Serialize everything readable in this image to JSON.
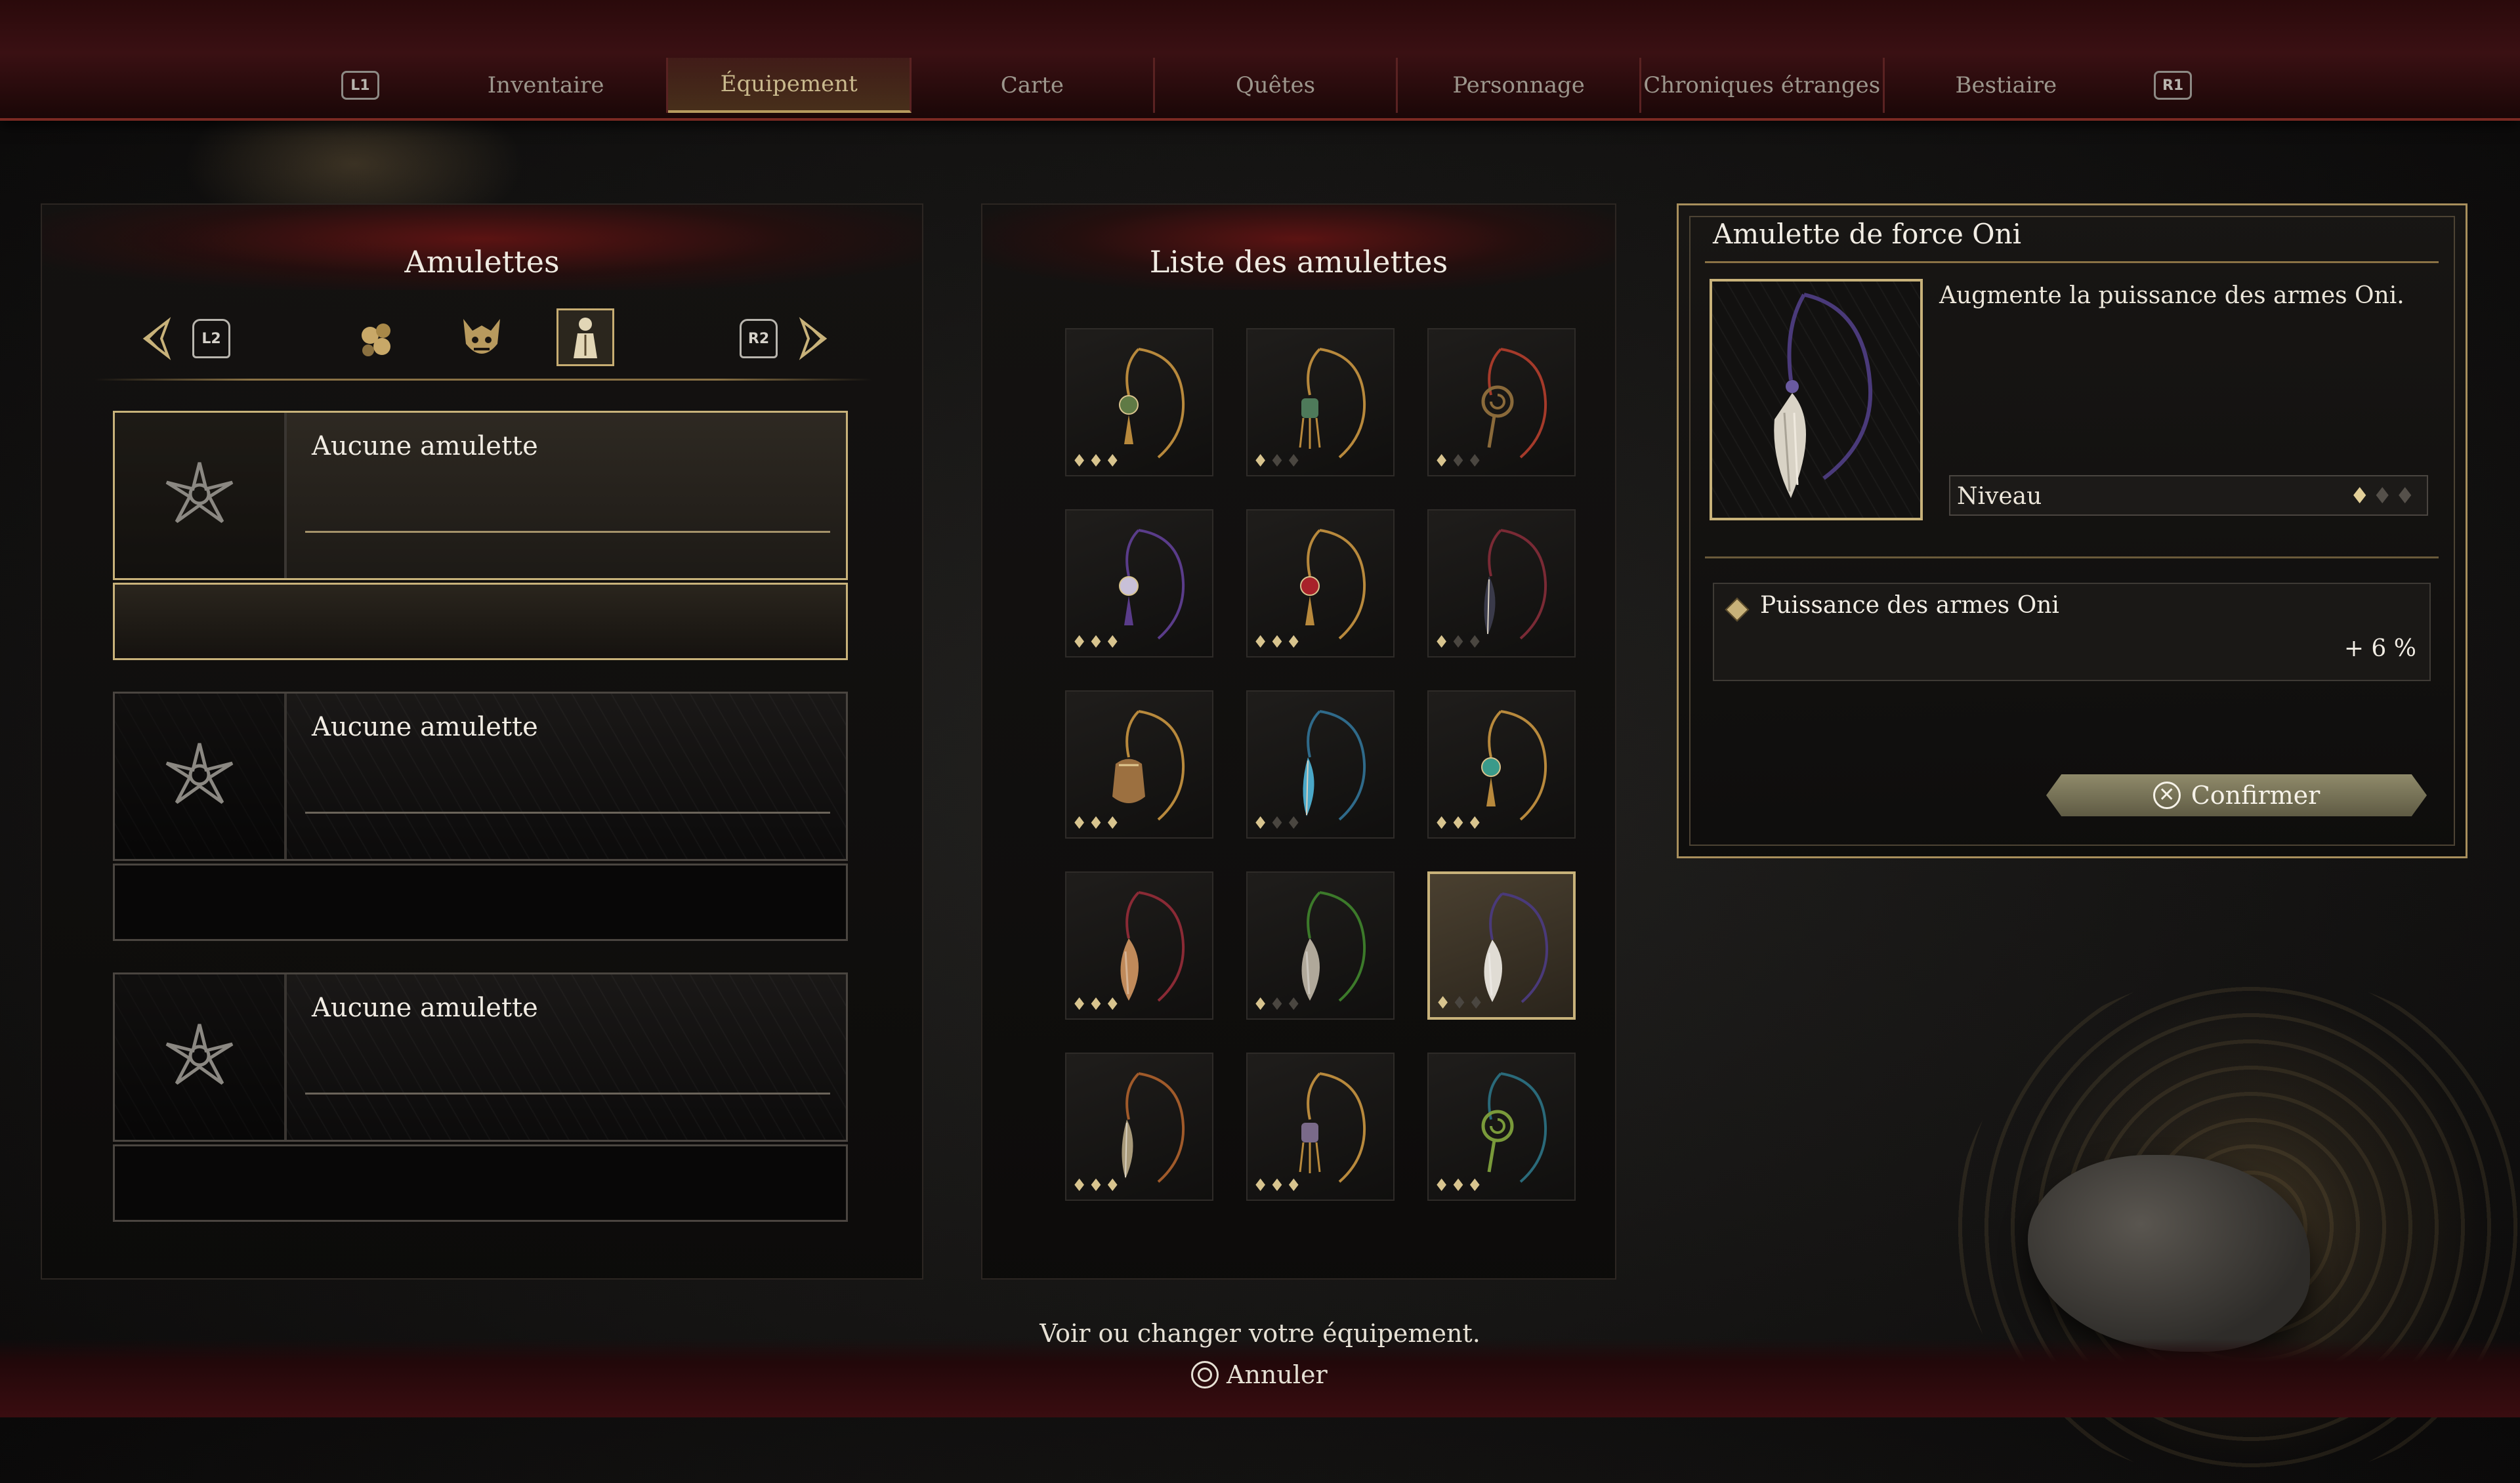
{
  "nav": {
    "left_button": "L1",
    "right_button": "R1",
    "tabs": [
      "Inventaire",
      "Équipement",
      "Carte",
      "Quêtes",
      "Personnage",
      "Chroniques étranges",
      "Bestiaire"
    ],
    "active_index": 1
  },
  "left_panel": {
    "title": "Amulettes",
    "left_trigger": "L2",
    "right_trigger": "R2",
    "categories": [
      "beads-category-icon",
      "oni-mask-category-icon",
      "robed-figure-category-icon"
    ],
    "active_category": 2,
    "slots": [
      {
        "name": "Aucune amulette",
        "selected": true
      },
      {
        "name": "Aucune amulette",
        "selected": false
      },
      {
        "name": "Aucune amulette",
        "selected": false
      }
    ]
  },
  "list_panel": {
    "title": "Liste des amulettes",
    "items": [
      {
        "color": "#b8893c",
        "gem": "#5f7a45",
        "kind": "orb",
        "level": 3
      },
      {
        "color": "#b8893c",
        "gem": "#4e7a5a",
        "kind": "tassel",
        "level": 1
      },
      {
        "color": "#a53a2a",
        "gem": "#8a6a3a",
        "kind": "swirl",
        "level": 1
      },
      {
        "color": "#5a3c8a",
        "gem": "#c8c0d8",
        "kind": "orb",
        "level": 3
      },
      {
        "color": "#b8893c",
        "gem": "#a8222a",
        "kind": "orb",
        "level": 3
      },
      {
        "color": "#7a2a35",
        "gem": "#3a3a4a",
        "kind": "feather",
        "level": 1
      },
      {
        "color": "#b8893c",
        "gem": "#9c7040",
        "kind": "pouch",
        "level": 3
      },
      {
        "color": "#2f6a8a",
        "gem": "#4aa8c8",
        "kind": "feather",
        "level": 1
      },
      {
        "color": "#b8893c",
        "gem": "#3a9a8a",
        "kind": "orb",
        "level": 3
      },
      {
        "color": "#8a2a35",
        "gem": "#c08a5a",
        "kind": "fur",
        "level": 3
      },
      {
        "color": "#3c7a2a",
        "gem": "#b0a89a",
        "kind": "fur",
        "level": 1
      },
      {
        "color": "#4a3a7a",
        "gem": "#e0dcd4",
        "kind": "fur",
        "level": 1
      },
      {
        "color": "#a05a2a",
        "gem": "#a89a7a",
        "kind": "feather",
        "level": 3
      },
      {
        "color": "#b8893c",
        "gem": "#7a6a8a",
        "kind": "tassel",
        "level": 3
      },
      {
        "color": "#2a6a7a",
        "gem": "#7a9a3a",
        "kind": "swirl",
        "level": 3
      }
    ],
    "selected_index": 11
  },
  "detail": {
    "title": "Amulette de force Oni",
    "description": "Augmente la puissance des armes Oni.",
    "level_label": "Niveau",
    "level": 1,
    "level_max": 3,
    "stat_name": "Puissance des armes Oni",
    "stat_value": "+ 6 %",
    "confirm_label": "Confirmer",
    "confirm_button_glyph": "✕"
  },
  "footer": {
    "hint": "Voir ou changer votre équipement.",
    "cancel_label": "Annuler"
  }
}
